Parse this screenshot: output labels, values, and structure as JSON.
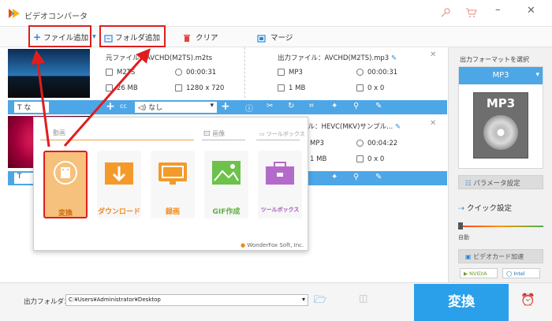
{
  "app": {
    "title": "ビデオコンバータ"
  },
  "toolbar": {
    "add_file": "ファイル追加",
    "add_folder": "フォルダ追加",
    "clear": "クリア",
    "merge": "マージ"
  },
  "rows": [
    {
      "src_label": "元ファイル：",
      "src_name": "AVCHD(M2TS).m2ts",
      "src_format": "M2TS",
      "src_duration": "00:00:31",
      "src_size": "26 MB",
      "src_resolution": "1280 x 720",
      "out_label": "出力ファイル：",
      "out_name": "AVCHD(M2TS).mp3",
      "out_format": "MP3",
      "out_duration": "00:00:31",
      "out_size": "1 MB",
      "out_resolution": "0 x 0"
    },
    {
      "out_name": "HEVC(MKV)サンプル...",
      "out_format": "MP3",
      "out_duration": "00:04:22",
      "out_size": "1 MB",
      "out_resolution": "0 x 0"
    }
  ],
  "edit_bar": {
    "text_short": "な",
    "audio_track": "なし",
    "cc": "cc"
  },
  "popup": {
    "cat_video": "動画",
    "cat_image": "画像",
    "cat_toolbox": "ツールボックス",
    "tiles": [
      {
        "label": "変換"
      },
      {
        "label": "ダウンロード"
      },
      {
        "label": "録画"
      },
      {
        "label": "GIF作成"
      },
      {
        "label": "ツールボックス"
      }
    ],
    "brand": "WonderFox Soft, Inc."
  },
  "sidebar": {
    "select_format": "出力フォーマットを選択",
    "format": "MP3",
    "param": "パラメータ設定",
    "quick": "クイック設定",
    "auto": "自動",
    "gpu": "ビデオカード加速",
    "nvidia": "NVIDIA",
    "intel": "Intel"
  },
  "bottom": {
    "out_folder_label": "出力フォルダ：",
    "out_folder_path": "C:¥Users¥Administrator¥Desktop",
    "convert": "変換"
  },
  "colors": {
    "accent": "#4da6e6",
    "highlight": "#e01d1d",
    "convert": "#2aa0ea"
  }
}
